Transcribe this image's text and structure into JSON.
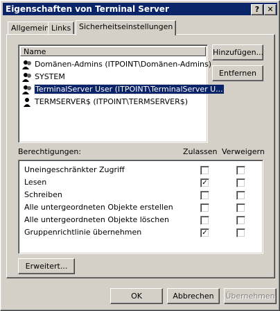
{
  "window": {
    "title": "Eigenschaften von Terminal Server",
    "help_btn": "?",
    "close_btn": "✕"
  },
  "tabs": [
    {
      "label": "Allgemein"
    },
    {
      "label": "Links"
    },
    {
      "label": "Sicherheitseinstellungen"
    }
  ],
  "users": {
    "header": "Name",
    "items": [
      {
        "label": "Domänen-Admins (ITPOINT\\Domänen-Admins)",
        "selected": false
      },
      {
        "label": "SYSTEM",
        "selected": false
      },
      {
        "label": "TerminalServer User (ITPOINT\\TerminalServer U...",
        "selected": true
      },
      {
        "label": "TERMSERVER$ (ITPOINT\\TERMSERVER$)",
        "selected": false
      }
    ]
  },
  "buttons": {
    "add": "Hinzufügen...",
    "remove": "Entfernen",
    "advanced": "Erweitert...",
    "ok": "OK",
    "cancel": "Abbrechen",
    "apply": "Übernehmen"
  },
  "permissions": {
    "label": "Berechtigungen:",
    "allow_header": "Zulassen",
    "deny_header": "Verweigern",
    "items": [
      {
        "label": "Uneingeschränkter Zugriff",
        "allow": false,
        "deny": false
      },
      {
        "label": "Lesen",
        "allow": true,
        "deny": false
      },
      {
        "label": "Schreiben",
        "allow": false,
        "deny": false
      },
      {
        "label": "Alle untergeordneten Objekte erstellen",
        "allow": false,
        "deny": false
      },
      {
        "label": "Alle untergeordneten Objekte löschen",
        "allow": false,
        "deny": false
      },
      {
        "label": "Gruppenrichtlinie übernehmen",
        "allow": true,
        "deny": false
      }
    ]
  },
  "check_mark": "✓"
}
